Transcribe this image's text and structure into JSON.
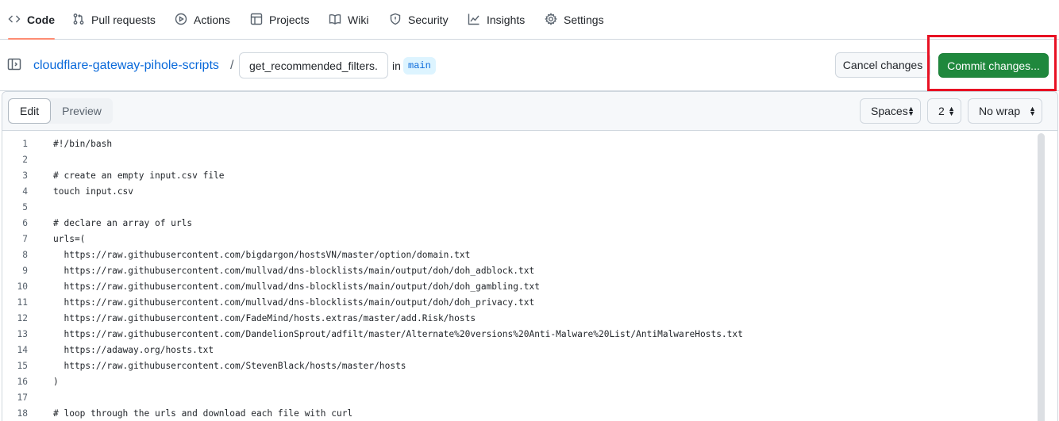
{
  "nav": {
    "items": [
      {
        "label": "Code",
        "icon": "code-icon"
      },
      {
        "label": "Pull requests",
        "icon": "git-pull-request-icon"
      },
      {
        "label": "Actions",
        "icon": "play-icon"
      },
      {
        "label": "Projects",
        "icon": "table-icon"
      },
      {
        "label": "Wiki",
        "icon": "book-icon"
      },
      {
        "label": "Security",
        "icon": "shield-icon"
      },
      {
        "label": "Insights",
        "icon": "graph-icon"
      },
      {
        "label": "Settings",
        "icon": "gear-icon"
      }
    ],
    "active_index": 0,
    "active_color": "#fd8c73"
  },
  "file_header": {
    "repo_name": "cloudflare-gateway-pihole-scripts",
    "separator": "/",
    "filename_value": "get_recommended_filters.s",
    "in_label": "in",
    "branch": "main",
    "cancel_label": "Cancel changes",
    "commit_label": "Commit changes...",
    "commit_color": "#1f883d",
    "highlight_color": "#e81123"
  },
  "editor": {
    "tabs": [
      "Edit",
      "Preview"
    ],
    "active_tab": "Edit",
    "indent_mode": "Spaces",
    "indent_size": "2",
    "wrap_mode": "No wrap",
    "lines": [
      {
        "n": "1",
        "text": "#!/bin/bash"
      },
      {
        "n": "2",
        "text": ""
      },
      {
        "n": "3",
        "text": "# create an empty input.csv file"
      },
      {
        "n": "4",
        "text": "touch input.csv"
      },
      {
        "n": "5",
        "text": ""
      },
      {
        "n": "6",
        "text": "# declare an array of urls"
      },
      {
        "n": "7",
        "text": "urls=("
      },
      {
        "n": "8",
        "text": "  https://raw.githubusercontent.com/bigdargon/hostsVN/master/option/domain.txt"
      },
      {
        "n": "9",
        "text": "  https://raw.githubusercontent.com/mullvad/dns-blocklists/main/output/doh/doh_adblock.txt"
      },
      {
        "n": "10",
        "text": "  https://raw.githubusercontent.com/mullvad/dns-blocklists/main/output/doh/doh_gambling.txt"
      },
      {
        "n": "11",
        "text": "  https://raw.githubusercontent.com/mullvad/dns-blocklists/main/output/doh/doh_privacy.txt"
      },
      {
        "n": "12",
        "text": "  https://raw.githubusercontent.com/FadeMind/hosts.extras/master/add.Risk/hosts"
      },
      {
        "n": "13",
        "text": "  https://raw.githubusercontent.com/DandelionSprout/adfilt/master/Alternate%20versions%20Anti-Malware%20List/AntiMalwareHosts.txt"
      },
      {
        "n": "14",
        "text": "  https://adaway.org/hosts.txt"
      },
      {
        "n": "15",
        "text": "  https://raw.githubusercontent.com/StevenBlack/hosts/master/hosts"
      },
      {
        "n": "16",
        "text": ")"
      },
      {
        "n": "17",
        "text": ""
      },
      {
        "n": "18",
        "text": "# loop through the urls and download each file with curl"
      }
    ]
  }
}
